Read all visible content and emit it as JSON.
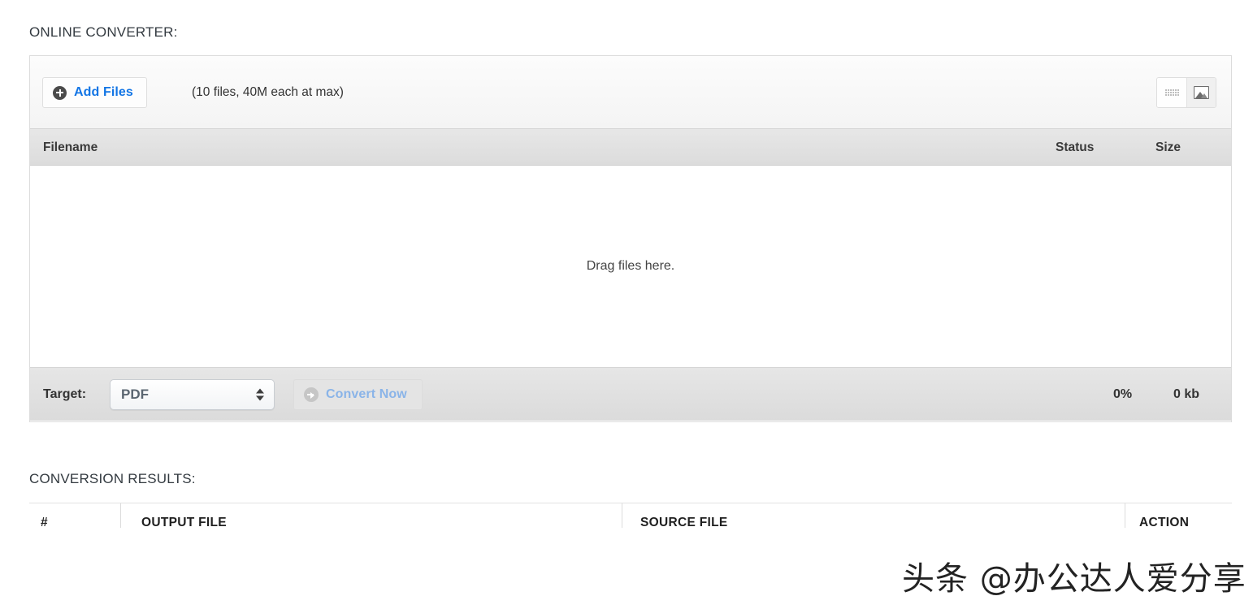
{
  "sections": {
    "converter_heading": "ONLINE CONVERTER:",
    "results_heading": "CONVERSION RESULTS:"
  },
  "toolbar": {
    "add_files_label": "Add Files",
    "add_files_icon": "plus-circle-icon",
    "files_hint": "(10 files, 40M each at max)",
    "view_toggle": [
      {
        "icon": "grid-view-icon",
        "active": false
      },
      {
        "icon": "image-view-icon",
        "active": true
      }
    ]
  },
  "file_table": {
    "columns": [
      "Filename",
      "Status",
      "Size"
    ],
    "rows": [],
    "empty_message": "Drag files here."
  },
  "footer": {
    "target_label": "Target:",
    "target_value": "PDF",
    "target_options": [
      "PDF"
    ],
    "convert_label": "Convert Now",
    "convert_icon": "arrow-circle-right-icon",
    "convert_disabled": true,
    "progress_percent": "0%",
    "total_size": "0 kb"
  },
  "results_table": {
    "columns": [
      "#",
      "OUTPUT FILE",
      "SOURCE FILE",
      "ACTION"
    ],
    "rows": []
  },
  "watermark": {
    "text": "头条 @办公达人爱分享"
  },
  "colors": {
    "link_blue": "#1275e5",
    "disabled_blue": "#8ab4e8",
    "panel_border": "#dcdcdc",
    "header_gradient_top": "#e7e7e7",
    "header_gradient_bottom": "#dcdcdc"
  }
}
